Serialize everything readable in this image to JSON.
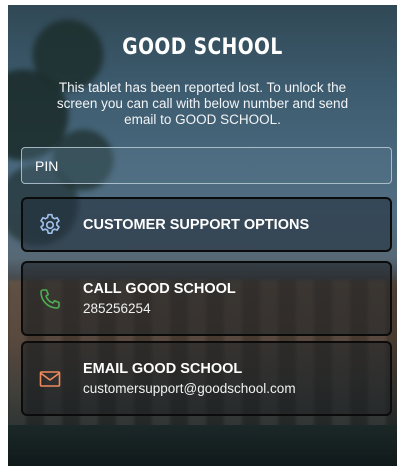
{
  "title": "GOOD SCHOOL",
  "message": "This tablet has been reported lost. To unlock the screen you can call with below number and send email to GOOD SCHOOL.",
  "pin": {
    "placeholder": "PIN",
    "value": ""
  },
  "actions": {
    "support": {
      "icon": "gear-icon",
      "label": "CUSTOMER SUPPORT OPTIONS",
      "icon_color": "#9fc0ea"
    },
    "call": {
      "icon": "phone-icon",
      "label": "CALL GOOD SCHOOL",
      "detail": "285256254",
      "icon_color": "#4caf50"
    },
    "email": {
      "icon": "envelope-icon",
      "label": "EMAIL GOOD SCHOOL",
      "detail": "customersupport@goodschool.com",
      "icon_color": "#f08a5d"
    }
  }
}
